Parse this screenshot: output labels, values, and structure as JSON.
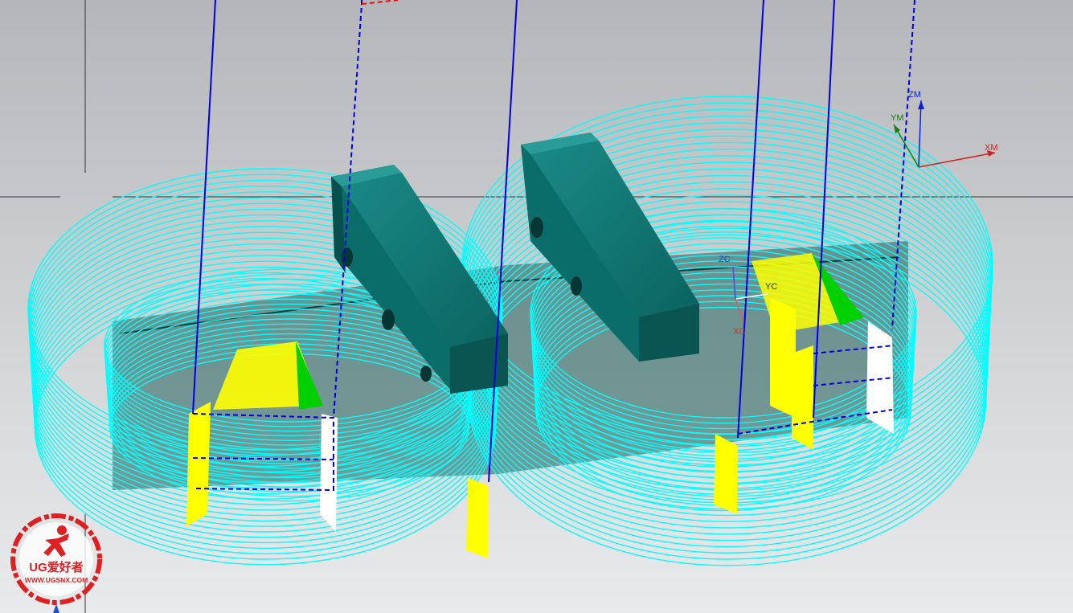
{
  "wcs_axes": {
    "x_label": "XM",
    "y_label": "YM",
    "z_label": "ZM"
  },
  "csys_axes": {
    "x_label": "XC",
    "y_label": "YC",
    "z_label": "ZC"
  },
  "watermark": {
    "title": "UG爱好者",
    "url": "WWW.UGSNX.COM"
  },
  "colors": {
    "toolpath": "#00ffff",
    "part": "#0d7a76",
    "engage": "#0000ff",
    "rapid": "#ff0000",
    "non_cut_fill": "#ffff00",
    "cut_fill": "#00d000",
    "background_top": "#b4b6b9",
    "background_bottom": "#e9eaeb"
  }
}
